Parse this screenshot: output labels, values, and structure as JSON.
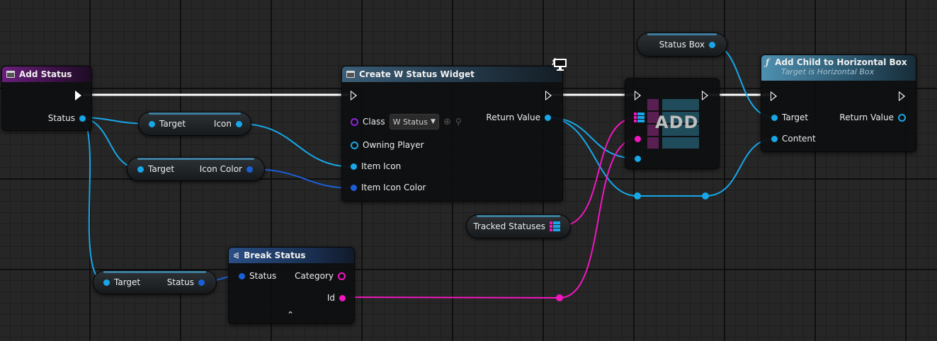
{
  "nodes": {
    "add_status": {
      "title": "Add Status",
      "out_status": "Status"
    },
    "create_widget": {
      "title": "Create W Status Widget",
      "class_label": "Class",
      "class_value": "W Status",
      "owning_player": "Owning Player",
      "item_icon": "Item Icon",
      "item_icon_color": "Item Icon Color",
      "return_value": "Return Value"
    },
    "add_array": {
      "label": "ADD"
    },
    "add_child": {
      "title": "Add Child to Horizontal Box",
      "subtitle": "Target is Horizontal Box",
      "target": "Target",
      "content": "Content",
      "return_value": "Return Value"
    },
    "break_status": {
      "title": "Break Status",
      "in_status": "Status",
      "category": "Category",
      "id": "Id"
    }
  },
  "vars": {
    "get_icon": {
      "target": "Target",
      "out": "Icon"
    },
    "get_icon_color": {
      "target": "Target",
      "out": "Icon Color"
    },
    "get_status": {
      "target": "Target",
      "out": "Status"
    },
    "status_box": {
      "label": "Status Box"
    },
    "tracked_statuses": {
      "label": "Tracked Statuses"
    }
  },
  "colors": {
    "object_pin": "#17a7e8",
    "struct_pin": "#1b5fd6",
    "name_pin": "#f316c0",
    "class_pin": "#8b25e0",
    "exec": "#ffffff"
  }
}
